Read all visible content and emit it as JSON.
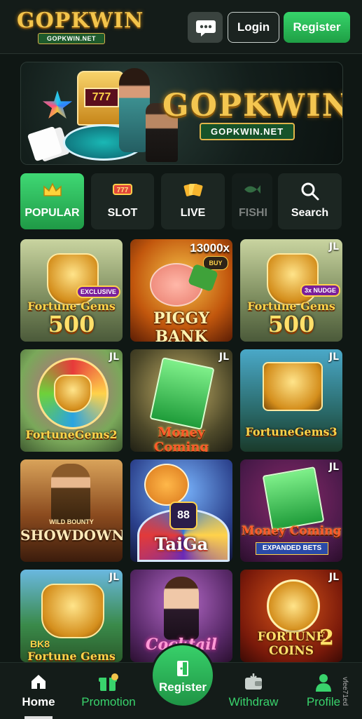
{
  "header": {
    "logo_text": "GOPKWIN",
    "logo_subtext": "GOPKWIN.NET",
    "chat_icon": "chat-bubble-icon",
    "login_label": "Login",
    "register_label": "Register"
  },
  "banner": {
    "title": "GOPKWIN",
    "subtitle": "GOPKWIN.NET",
    "slot_reels": "777"
  },
  "tabs": [
    {
      "label": "POPULAR",
      "icon": "crown-icon",
      "active": true
    },
    {
      "label": "SLOT",
      "icon": "slot-777-icon",
      "active": false
    },
    {
      "label": "LIVE",
      "icon": "cards-icon",
      "active": false
    },
    {
      "label": "FISHI",
      "icon": "fish-icon",
      "active": false
    },
    {
      "label": "Search",
      "icon": "search-icon",
      "active": false
    }
  ],
  "games": [
    {
      "title": "Fortune Gems",
      "number": "500",
      "badge": "EXCLUSIVE",
      "provider": ""
    },
    {
      "title": "PIGGY BANK",
      "multiplier": "13000x",
      "buy": "BUY",
      "provider": ""
    },
    {
      "title": "Fortune Gems",
      "number": "500",
      "badge": "3x NUDGE",
      "provider": "JL"
    },
    {
      "title": "FortuneGems2",
      "provider": "JL"
    },
    {
      "title": "Money Coming",
      "provider": "JL"
    },
    {
      "title": "FortuneGems3",
      "provider": "JL"
    },
    {
      "title": "SHOWDOWN",
      "badge": "WILD BOUNTY",
      "provider": ""
    },
    {
      "title": "TaiGa",
      "number": "88",
      "provider": ""
    },
    {
      "title": "Money Coming",
      "badge": "EXPANDED BETS",
      "provider": "JL"
    },
    {
      "title": "Fortune Gems",
      "badge": "BK8",
      "provider": "JL"
    },
    {
      "title": "Cocktail",
      "provider": ""
    },
    {
      "title": "FORTUNE COINS",
      "number": "2",
      "provider": "JL"
    }
  ],
  "bottom_nav": {
    "home": "Home",
    "promotion": "Promotion",
    "register": "Register",
    "withdraw": "Withdraw",
    "profile": "Profile"
  },
  "watermark": "vfee71ed",
  "colors": {
    "background": "#0f1714",
    "accent_green": "#2bbf57",
    "gold": "#f3c44b"
  }
}
